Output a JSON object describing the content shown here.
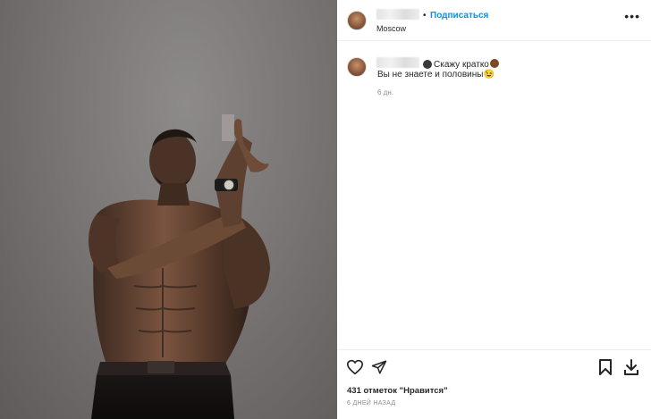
{
  "post": {
    "follow_label": "Подписаться",
    "separator": "•",
    "location": "Moscow",
    "more_icon": "more-horizontal-icon"
  },
  "comment": {
    "text_line1": "Скажу кратко",
    "text_line2": "Вы не знаете и половины",
    "emoji_end": "😉",
    "time_ago": "6 дн."
  },
  "actions": {
    "like_icon": "heart-icon",
    "share_icon": "paper-plane-icon",
    "save_icon": "bookmark-icon",
    "download_icon": "download-icon"
  },
  "stats": {
    "likes_text": "431 отметок \"Нравится\"",
    "date_text": "6 ДНЕЙ НАЗАД"
  },
  "colors": {
    "follow": "#0095f6",
    "photo_bg": "#7a7676",
    "skin": "#6b4a36"
  }
}
